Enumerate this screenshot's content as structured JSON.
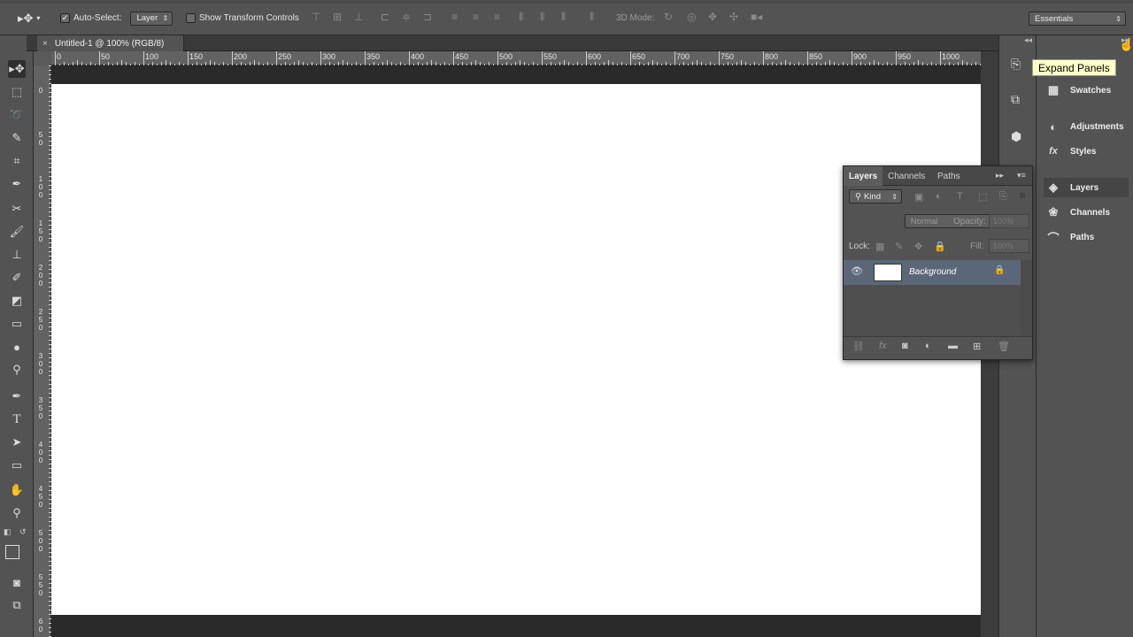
{
  "options_bar": {
    "auto_select_label": "Auto-Select:",
    "auto_select_value": "Layer",
    "show_transform_label": "Show Transform Controls",
    "mode_3d_label": "3D Mode:",
    "workspace_value": "Essentials"
  },
  "document_tab": {
    "title": "Untitled-1 @ 100% (RGB/8)",
    "close": "×"
  },
  "ruler": {
    "h_ticks": [
      "0",
      "50",
      "100",
      "150",
      "200",
      "250",
      "300",
      "350",
      "400",
      "450",
      "500",
      "550",
      "600",
      "650",
      "700",
      "750",
      "800",
      "850",
      "900",
      "950",
      "1000"
    ],
    "v_ticks": [
      "0",
      "5 0",
      "1 0 0",
      "1 5 0",
      "2 0 0",
      "2 5 0",
      "3 0 0",
      "3 5 0",
      "4 0 0",
      "4 5 0",
      "5 0 0",
      "5 5 0",
      "6 0"
    ]
  },
  "dock": {
    "tooltip": "Expand Panels",
    "items": [
      {
        "label": "Swatches",
        "icon": "grid-icon"
      },
      {
        "label": "Adjustments",
        "icon": "adjust-icon"
      },
      {
        "label": "Styles",
        "icon": "fx-icon"
      },
      {
        "label": "Layers",
        "icon": "layers-icon"
      },
      {
        "label": "Channels",
        "icon": "channels-icon"
      },
      {
        "label": "Paths",
        "icon": "paths-icon"
      }
    ]
  },
  "layers_panel": {
    "tabs": [
      "Layers",
      "Channels",
      "Paths"
    ],
    "filter_kind": "Kind",
    "blend_mode": "Normal",
    "opacity_label": "Opacity:",
    "opacity_value": "100%",
    "lock_label": "Lock:",
    "fill_label": "Fill:",
    "fill_value": "100%",
    "layer_name": "Background"
  }
}
